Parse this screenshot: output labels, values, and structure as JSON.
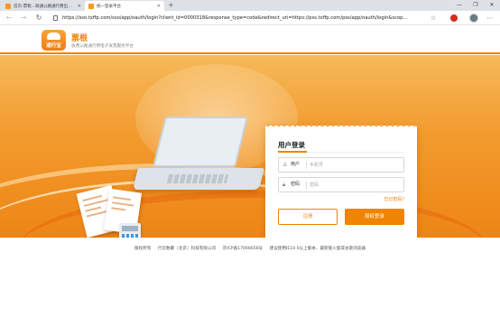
{
  "browser": {
    "tabs": [
      {
        "title": "首页-票税…联通公路通行费出…",
        "active": false
      },
      {
        "title": "统一登录平台",
        "active": true
      }
    ],
    "url": "https://sso.txffp.com/sso/app/oauth/login?client_id=0000318&response_type=code&redirect_uri=https://pss.txffp.com/pss/app/oauth/login&scop..."
  },
  "header": {
    "logo_text": "通行宝",
    "brand_name": "票根",
    "brand_subtitle": "收费公路通行费电子发票服务平台"
  },
  "login": {
    "title": "用户登录",
    "username_label": "用户",
    "username_placeholder": "手机号",
    "password_label": "密码",
    "password_placeholder": "密码",
    "forgot_label": "忘记密码?",
    "register_label": "注册",
    "login_label": "授权登录"
  },
  "footer": {
    "copyright": "版权所有",
    "company": "行云数聚（北京）科技有限公司",
    "icp": "京ICP备17066656号",
    "browser_tip": "建议使用IE10.0以上版本、最新版火狐或谷歌浏览器"
  },
  "colors": {
    "accent": "#f08300",
    "hero_top": "#f6b95a",
    "hero_bottom": "#ee8516"
  }
}
